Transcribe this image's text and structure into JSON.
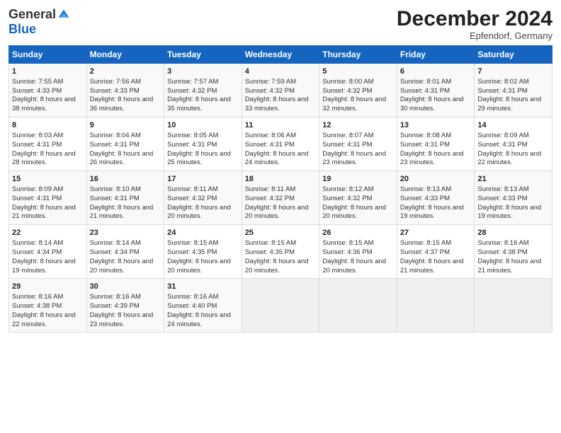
{
  "header": {
    "logo_general": "General",
    "logo_blue": "Blue",
    "month_year": "December 2024",
    "location": "Epfendorf, Germany"
  },
  "days_of_week": [
    "Sunday",
    "Monday",
    "Tuesday",
    "Wednesday",
    "Thursday",
    "Friday",
    "Saturday"
  ],
  "weeks": [
    [
      {
        "day": "1",
        "sunrise": "Sunrise: 7:55 AM",
        "sunset": "Sunset: 4:33 PM",
        "daylight": "Daylight: 8 hours and 38 minutes."
      },
      {
        "day": "2",
        "sunrise": "Sunrise: 7:56 AM",
        "sunset": "Sunset: 4:33 PM",
        "daylight": "Daylight: 8 hours and 36 minutes."
      },
      {
        "day": "3",
        "sunrise": "Sunrise: 7:57 AM",
        "sunset": "Sunset: 4:32 PM",
        "daylight": "Daylight: 8 hours and 35 minutes."
      },
      {
        "day": "4",
        "sunrise": "Sunrise: 7:59 AM",
        "sunset": "Sunset: 4:32 PM",
        "daylight": "Daylight: 8 hours and 33 minutes."
      },
      {
        "day": "5",
        "sunrise": "Sunrise: 8:00 AM",
        "sunset": "Sunset: 4:32 PM",
        "daylight": "Daylight: 8 hours and 32 minutes."
      },
      {
        "day": "6",
        "sunrise": "Sunrise: 8:01 AM",
        "sunset": "Sunset: 4:31 PM",
        "daylight": "Daylight: 8 hours and 30 minutes."
      },
      {
        "day": "7",
        "sunrise": "Sunrise: 8:02 AM",
        "sunset": "Sunset: 4:31 PM",
        "daylight": "Daylight: 8 hours and 29 minutes."
      }
    ],
    [
      {
        "day": "8",
        "sunrise": "Sunrise: 8:03 AM",
        "sunset": "Sunset: 4:31 PM",
        "daylight": "Daylight: 8 hours and 28 minutes."
      },
      {
        "day": "9",
        "sunrise": "Sunrise: 8:04 AM",
        "sunset": "Sunset: 4:31 PM",
        "daylight": "Daylight: 8 hours and 26 minutes."
      },
      {
        "day": "10",
        "sunrise": "Sunrise: 8:05 AM",
        "sunset": "Sunset: 4:31 PM",
        "daylight": "Daylight: 8 hours and 25 minutes."
      },
      {
        "day": "11",
        "sunrise": "Sunrise: 8:06 AM",
        "sunset": "Sunset: 4:31 PM",
        "daylight": "Daylight: 8 hours and 24 minutes."
      },
      {
        "day": "12",
        "sunrise": "Sunrise: 8:07 AM",
        "sunset": "Sunset: 4:31 PM",
        "daylight": "Daylight: 8 hours and 23 minutes."
      },
      {
        "day": "13",
        "sunrise": "Sunrise: 8:08 AM",
        "sunset": "Sunset: 4:31 PM",
        "daylight": "Daylight: 8 hours and 23 minutes."
      },
      {
        "day": "14",
        "sunrise": "Sunrise: 8:09 AM",
        "sunset": "Sunset: 4:31 PM",
        "daylight": "Daylight: 8 hours and 22 minutes."
      }
    ],
    [
      {
        "day": "15",
        "sunrise": "Sunrise: 8:09 AM",
        "sunset": "Sunset: 4:31 PM",
        "daylight": "Daylight: 8 hours and 21 minutes."
      },
      {
        "day": "16",
        "sunrise": "Sunrise: 8:10 AM",
        "sunset": "Sunset: 4:31 PM",
        "daylight": "Daylight: 8 hours and 21 minutes."
      },
      {
        "day": "17",
        "sunrise": "Sunrise: 8:11 AM",
        "sunset": "Sunset: 4:32 PM",
        "daylight": "Daylight: 8 hours and 20 minutes."
      },
      {
        "day": "18",
        "sunrise": "Sunrise: 8:11 AM",
        "sunset": "Sunset: 4:32 PM",
        "daylight": "Daylight: 8 hours and 20 minutes."
      },
      {
        "day": "19",
        "sunrise": "Sunrise: 8:12 AM",
        "sunset": "Sunset: 4:32 PM",
        "daylight": "Daylight: 8 hours and 20 minutes."
      },
      {
        "day": "20",
        "sunrise": "Sunrise: 8:13 AM",
        "sunset": "Sunset: 4:33 PM",
        "daylight": "Daylight: 8 hours and 19 minutes."
      },
      {
        "day": "21",
        "sunrise": "Sunrise: 8:13 AM",
        "sunset": "Sunset: 4:33 PM",
        "daylight": "Daylight: 8 hours and 19 minutes."
      }
    ],
    [
      {
        "day": "22",
        "sunrise": "Sunrise: 8:14 AM",
        "sunset": "Sunset: 4:34 PM",
        "daylight": "Daylight: 8 hours and 19 minutes."
      },
      {
        "day": "23",
        "sunrise": "Sunrise: 8:14 AM",
        "sunset": "Sunset: 4:34 PM",
        "daylight": "Daylight: 8 hours and 20 minutes."
      },
      {
        "day": "24",
        "sunrise": "Sunrise: 8:15 AM",
        "sunset": "Sunset: 4:35 PM",
        "daylight": "Daylight: 8 hours and 20 minutes."
      },
      {
        "day": "25",
        "sunrise": "Sunrise: 8:15 AM",
        "sunset": "Sunset: 4:35 PM",
        "daylight": "Daylight: 8 hours and 20 minutes."
      },
      {
        "day": "26",
        "sunrise": "Sunrise: 8:15 AM",
        "sunset": "Sunset: 4:36 PM",
        "daylight": "Daylight: 8 hours and 20 minutes."
      },
      {
        "day": "27",
        "sunrise": "Sunrise: 8:15 AM",
        "sunset": "Sunset: 4:37 PM",
        "daylight": "Daylight: 8 hours and 21 minutes."
      },
      {
        "day": "28",
        "sunrise": "Sunrise: 8:16 AM",
        "sunset": "Sunset: 4:38 PM",
        "daylight": "Daylight: 8 hours and 21 minutes."
      }
    ],
    [
      {
        "day": "29",
        "sunrise": "Sunrise: 8:16 AM",
        "sunset": "Sunset: 4:38 PM",
        "daylight": "Daylight: 8 hours and 22 minutes."
      },
      {
        "day": "30",
        "sunrise": "Sunrise: 8:16 AM",
        "sunset": "Sunset: 4:39 PM",
        "daylight": "Daylight: 8 hours and 23 minutes."
      },
      {
        "day": "31",
        "sunrise": "Sunrise: 8:16 AM",
        "sunset": "Sunset: 4:40 PM",
        "daylight": "Daylight: 8 hours and 24 minutes."
      },
      null,
      null,
      null,
      null
    ]
  ]
}
